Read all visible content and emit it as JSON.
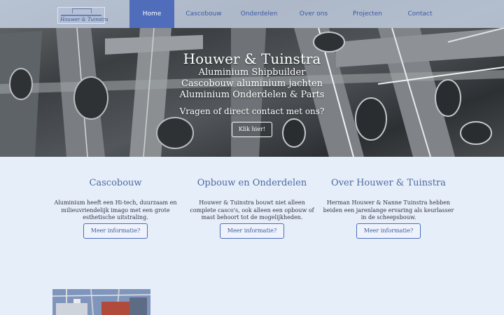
{
  "nav": {
    "logo_text": "Houwer & Tuinstra",
    "items": [
      {
        "label": "Home",
        "active": true
      },
      {
        "label": "Cascobouw",
        "active": false
      },
      {
        "label": "Onderdelen",
        "active": false
      },
      {
        "label": "Over ons",
        "active": false
      },
      {
        "label": "Projecten",
        "active": false
      },
      {
        "label": "Contact",
        "active": false
      }
    ]
  },
  "hero": {
    "title": "Houwer & Tuinstra",
    "subtitles": [
      "Aluminium Shipbuilder",
      "Cascobouw aluminium jachten",
      "Aluminium Onderdelen & Parts"
    ],
    "question": "Vragen of direct contact met ons?",
    "cta_label": "Klik hier!"
  },
  "features": [
    {
      "title": "Cascobouw",
      "text": "Aluminium heeft een Hi-tech, duurzaam en milieuvriendelijk imago met een grote esthetische uitstraling.",
      "button": "Meer informatie?"
    },
    {
      "title": "Opbouw en Onderdelen",
      "text": "Houwer & Tuinstra bouwt niet alleen complete casco's, ook alleen een opbouw of mast behoort tot de mogelijkheden.",
      "button": "Meer informatie?"
    },
    {
      "title": "Over Houwer & Tuinstra",
      "text": "Herman Houwer & Nanne Tuinstra hebben beiden een jarenlange ervaring als keurlasser in de scheepsbouw.",
      "button": "Meer informatie?"
    }
  ],
  "colors": {
    "accent": "#4f6dbb",
    "heading": "#4d6aa3",
    "page_bg": "#e6eef9"
  }
}
